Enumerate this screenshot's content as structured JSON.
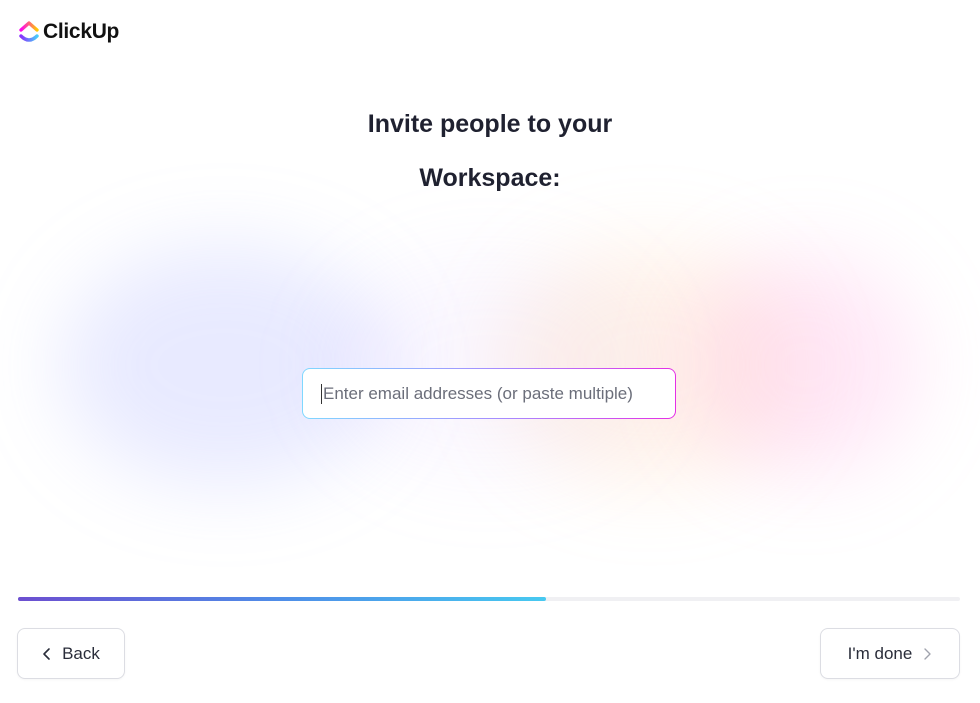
{
  "app": {
    "logo_text": "ClickUp",
    "brand_colors": [
      "#8930fd",
      "#49ccf9",
      "#ff02f0",
      "#ffc800"
    ]
  },
  "main": {
    "heading_line1": "Invite people to your",
    "heading_line2": "Workspace:",
    "email_input": {
      "value": "",
      "placeholder": "Enter email addresses (or paste multiple)"
    }
  },
  "progress": {
    "fraction": 0.56,
    "colors": [
      "#6c4fd0",
      "#47c9f0"
    ]
  },
  "footer": {
    "back_label": "Back",
    "back_icon": "chevron-left-icon",
    "done_label": "I'm done",
    "done_icon": "chevron-right-icon"
  }
}
